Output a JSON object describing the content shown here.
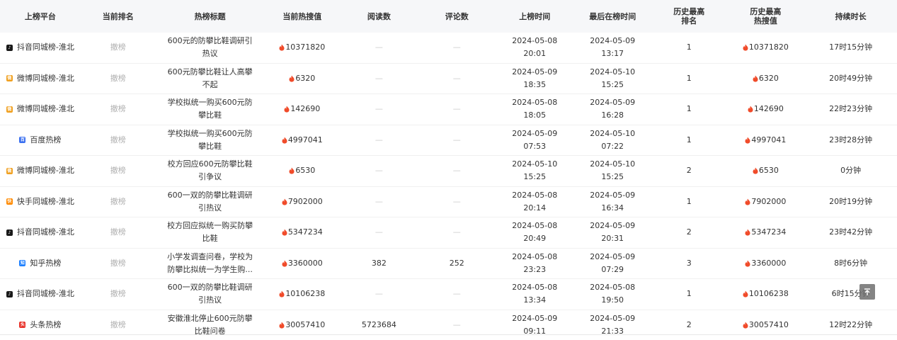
{
  "headers": [
    "上榜平台",
    "当前排名",
    "热榜标题",
    "当前热搜值",
    "阅读数",
    "评论数",
    "上榜时间",
    "最后在榜时间",
    "历史最高\n排名",
    "历史最高\n热搜值",
    "持续时长"
  ],
  "header_hist_rank": [
    "历史最高",
    "排名"
  ],
  "header_hist_heat": [
    "历史最高",
    "热搜值"
  ],
  "icon_colors": {
    "douyin": "#1a1a1a",
    "weibo": "#f0a020",
    "baidu": "#3a6ff0",
    "kuaishou": "#ff8a00",
    "zhihu": "#1e80ff",
    "toutiao": "#e8342c",
    "flame": "#f04b2a"
  },
  "rows": [
    {
      "platform": "抖音同城榜-淮北",
      "icon": "douyin",
      "rank": "撤榜",
      "title": "600元的防攀比鞋调研引热议",
      "heat": "10371820",
      "reads": "—",
      "comments": "—",
      "on_date": "2024-05-08",
      "on_time": "20:01",
      "last_date": "2024-05-09",
      "last_time": "13:17",
      "hist_rank": "1",
      "hist_heat": "10371820",
      "duration": "17时15分钟"
    },
    {
      "platform": "微博同城榜-淮北",
      "icon": "weibo",
      "rank": "撤榜",
      "title": "600元防攀比鞋让人高攀不起",
      "heat": "6320",
      "reads": "—",
      "comments": "—",
      "on_date": "2024-05-09",
      "on_time": "18:35",
      "last_date": "2024-05-10",
      "last_time": "15:25",
      "hist_rank": "1",
      "hist_heat": "6320",
      "duration": "20时49分钟"
    },
    {
      "platform": "微博同城榜-淮北",
      "icon": "weibo",
      "rank": "撤榜",
      "title": "学校拟统一购买600元防攀比鞋",
      "heat": "142690",
      "reads": "—",
      "comments": "—",
      "on_date": "2024-05-08",
      "on_time": "18:05",
      "last_date": "2024-05-09",
      "last_time": "16:28",
      "hist_rank": "1",
      "hist_heat": "142690",
      "duration": "22时23分钟"
    },
    {
      "platform": "百度热榜",
      "icon": "baidu",
      "rank": "撤榜",
      "title": "学校拟统一购买600元防攀比鞋",
      "heat": "4997041",
      "reads": "—",
      "comments": "—",
      "on_date": "2024-05-09",
      "on_time": "07:53",
      "last_date": "2024-05-10",
      "last_time": "07:22",
      "hist_rank": "1",
      "hist_heat": "4997041",
      "duration": "23时28分钟"
    },
    {
      "platform": "微博同城榜-淮北",
      "icon": "weibo",
      "rank": "撤榜",
      "title": "校方回应600元防攀比鞋引争议",
      "heat": "6530",
      "reads": "—",
      "comments": "—",
      "on_date": "2024-05-10",
      "on_time": "15:25",
      "last_date": "2024-05-10",
      "last_time": "15:25",
      "hist_rank": "2",
      "hist_heat": "6530",
      "duration": "0分钟"
    },
    {
      "platform": "快手同城榜-淮北",
      "icon": "kuaishou",
      "rank": "撤榜",
      "title": "600一双的防攀比鞋调研引热议",
      "heat": "7902000",
      "reads": "—",
      "comments": "—",
      "on_date": "2024-05-08",
      "on_time": "20:14",
      "last_date": "2024-05-09",
      "last_time": "16:34",
      "hist_rank": "1",
      "hist_heat": "7902000",
      "duration": "20时19分钟"
    },
    {
      "platform": "抖音同城榜-淮北",
      "icon": "douyin",
      "rank": "撤榜",
      "title": "校方回应拟统一购买防攀比鞋",
      "heat": "5347234",
      "reads": "—",
      "comments": "—",
      "on_date": "2024-05-08",
      "on_time": "20:49",
      "last_date": "2024-05-09",
      "last_time": "20:31",
      "hist_rank": "2",
      "hist_heat": "5347234",
      "duration": "23时42分钟"
    },
    {
      "platform": "知乎热榜",
      "icon": "zhihu",
      "rank": "撤榜",
      "title": "小学发调查问卷，学校为防攀比拟统一为学生购...",
      "heat": "3360000",
      "reads": "382",
      "comments": "252",
      "on_date": "2024-05-08",
      "on_time": "23:23",
      "last_date": "2024-05-09",
      "last_time": "07:29",
      "hist_rank": "3",
      "hist_heat": "3360000",
      "duration": "8时6分钟"
    },
    {
      "platform": "抖音同城榜-淮北",
      "icon": "douyin",
      "rank": "撤榜",
      "title": "600一双的防攀比鞋调研引热议",
      "heat": "10106238",
      "reads": "—",
      "comments": "—",
      "on_date": "2024-05-08",
      "on_time": "13:34",
      "last_date": "2024-05-08",
      "last_time": "19:50",
      "hist_rank": "1",
      "hist_heat": "10106238",
      "duration": "6时15分钟"
    },
    {
      "platform": "头条热榜",
      "icon": "toutiao",
      "rank": "撤榜",
      "title": "安徽淮北停止600元防攀比鞋问卷",
      "heat": "30057410",
      "reads": "5723684",
      "comments": "—",
      "on_date": "2024-05-09",
      "on_time": "09:11",
      "last_date": "2024-05-09",
      "last_time": "21:33",
      "hist_rank": "2",
      "hist_heat": "30057410",
      "duration": "12时22分钟"
    }
  ]
}
